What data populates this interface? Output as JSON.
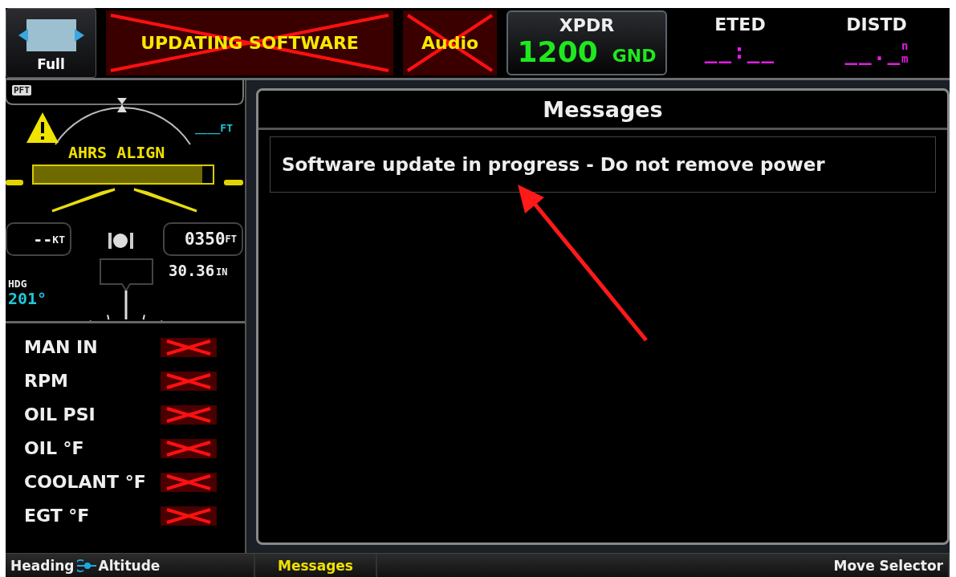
{
  "top_bar": {
    "full_button": {
      "label": "Full"
    },
    "annunciators": [
      {
        "label": "UPDATING SOFTWARE",
        "failed": true
      },
      {
        "label": "Audio",
        "failed": true
      }
    ],
    "xpdr": {
      "title": "XPDR",
      "code": "1200",
      "mode": "GND"
    },
    "fields": [
      {
        "title": "ETED",
        "value": "__:__"
      },
      {
        "title": "DISTD",
        "value": "__._",
        "unit_top": "n",
        "unit_bottom": "m"
      }
    ]
  },
  "pfd": {
    "tag": "PFT",
    "altitude_bug": "____FT",
    "status": "AHRS ALIGN",
    "alignment": {
      "level": 0.94
    },
    "speed": "--",
    "speed_unit": "KT",
    "altitude": "0350",
    "altitude_unit": "FT",
    "baro": "30.36",
    "baro_unit": "IN",
    "heading_label": "HDG",
    "heading": "201°"
  },
  "engine": [
    {
      "label": "MAN IN",
      "failed": true
    },
    {
      "label": "RPM",
      "failed": true
    },
    {
      "label": "OIL PSI",
      "failed": true
    },
    {
      "label": "OIL °F",
      "failed": true
    },
    {
      "label": "COOLANT °F",
      "failed": true
    },
    {
      "label": "EGT °F",
      "failed": true
    }
  ],
  "messages": {
    "title": "Messages",
    "items": [
      "Software update in progress - Do not remove power"
    ]
  },
  "softkeys": [
    {
      "kind": "pair",
      "left": "Heading",
      "right": "Altitude",
      "selected": false
    },
    {
      "kind": "plain",
      "label": "Messages",
      "selected": true
    },
    {
      "kind": "wide",
      "label": "Move Selector",
      "selected": false
    }
  ]
}
